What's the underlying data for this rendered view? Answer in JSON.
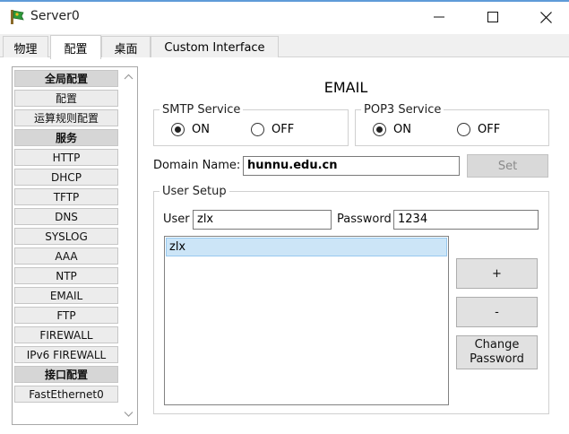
{
  "window": {
    "title": "Server0"
  },
  "tabs": [
    {
      "label": "物理"
    },
    {
      "label": "配置"
    },
    {
      "label": "桌面"
    },
    {
      "label": "Custom Interface"
    }
  ],
  "sidebar": {
    "items": [
      {
        "label": "全局配置",
        "header": true
      },
      {
        "label": "配置"
      },
      {
        "label": "运算规则配置"
      },
      {
        "label": "服务",
        "header": true
      },
      {
        "label": "HTTP"
      },
      {
        "label": "DHCP"
      },
      {
        "label": "TFTP"
      },
      {
        "label": "DNS"
      },
      {
        "label": "SYSLOG"
      },
      {
        "label": "AAA"
      },
      {
        "label": "NTP"
      },
      {
        "label": "EMAIL"
      },
      {
        "label": "FTP"
      },
      {
        "label": "FIREWALL"
      },
      {
        "label": "IPv6 FIREWALL"
      },
      {
        "label": "接口配置",
        "header": true
      },
      {
        "label": "FastEthernet0"
      }
    ]
  },
  "email": {
    "title": "EMAIL",
    "smtp": {
      "legend": "SMTP Service",
      "on_label": "ON",
      "off_label": "OFF",
      "selected": "ON"
    },
    "pop3": {
      "legend": "POP3 Service",
      "on_label": "ON",
      "off_label": "OFF",
      "selected": "ON"
    },
    "domain": {
      "label": "Domain Name:",
      "value": "hunnu.edu.cn",
      "set_label": "Set"
    },
    "user_setup": {
      "legend": "User Setup",
      "user_label": "User",
      "user_value": "zlx",
      "password_label": "Password",
      "password_value": "1234",
      "users": [
        "zlx"
      ],
      "add_label": "+",
      "remove_label": "-",
      "change_password_label": "Change Password"
    }
  }
}
